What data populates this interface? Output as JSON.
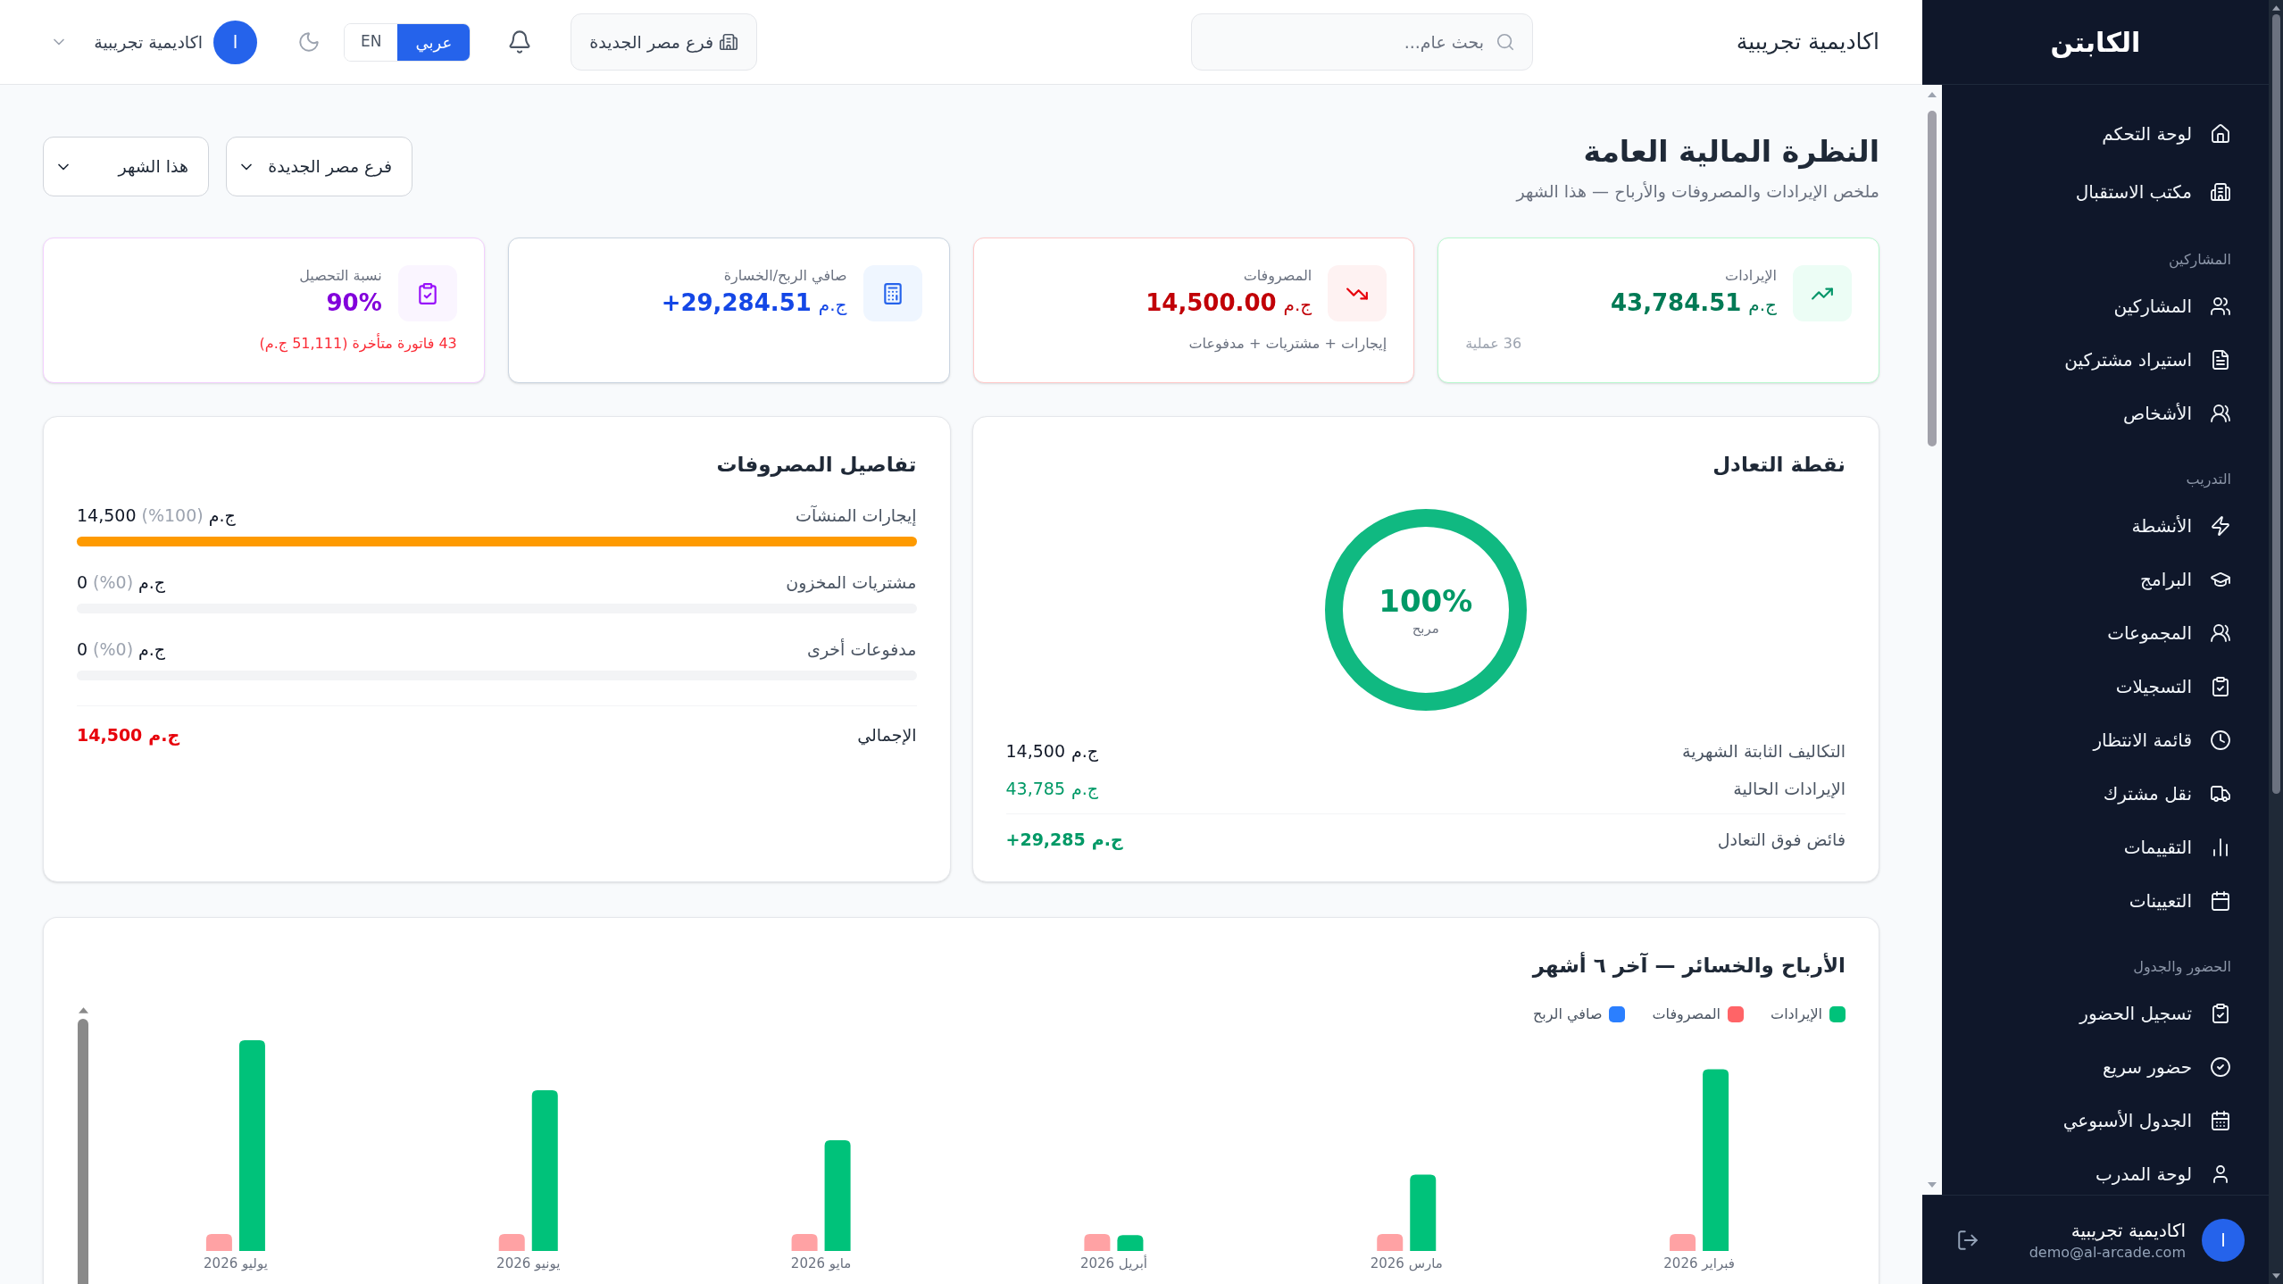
{
  "sidebar": {
    "brand": "الكابتن",
    "sections": [
      {
        "items": [
          {
            "label": "لوحة التحكم",
            "selected": false
          },
          {
            "label": "مكتب الاستقبال",
            "selected": false
          }
        ]
      },
      {
        "heading": "المشاركين",
        "items": [
          {
            "label": "المشاركين",
            "selected": false
          },
          {
            "label": "استيراد مشتركين",
            "selected": false
          },
          {
            "label": "الأشخاص",
            "selected": false
          }
        ]
      },
      {
        "heading": "التدريب",
        "items": [
          {
            "label": "الأنشطة",
            "selected": false
          },
          {
            "label": "البرامج",
            "selected": false
          },
          {
            "label": "المجموعات",
            "selected": false
          },
          {
            "label": "التسجيلات",
            "selected": false
          },
          {
            "label": "قائمة الانتظار",
            "selected": false
          },
          {
            "label": "نقل مشترك",
            "selected": false
          },
          {
            "label": "التقييمات",
            "selected": false
          },
          {
            "label": "التعيينات",
            "selected": false
          }
        ]
      },
      {
        "heading": "الحضور والجدول",
        "items": [
          {
            "label": "تسجيل الحضور",
            "selected": false
          },
          {
            "label": "حضور سريع",
            "selected": false
          },
          {
            "label": "الجدول الأسبوعي",
            "selected": false
          },
          {
            "label": "لوحة المدرب",
            "selected": false
          }
        ]
      }
    ],
    "user": {
      "initial": "ا",
      "name": "اكاديمية تجريبية",
      "email": "demo@al-arcade.com"
    }
  },
  "header": {
    "title": "اكاديمية تجريبية",
    "search": {
      "placeholder": "بحث عام..."
    },
    "branch_button": "فرع مصر الجديدة",
    "languages": [
      {
        "label": "عربي",
        "selected": true
      },
      {
        "label": "EN",
        "selected": false
      }
    ],
    "user": {
      "initial": "ا",
      "name": "اكاديمية تجريبية"
    }
  },
  "page": {
    "title": "النظرة المالية العامة",
    "subtitle": "ملخص الإيرادات والمصروفات والأرباح — هذا الشهر",
    "filters": [
      {
        "value": "فرع مصر الجديدة"
      },
      {
        "value": "هذا الشهر"
      }
    ]
  },
  "stat_cards": [
    {
      "kind": "revenue",
      "label": "الإيرادات",
      "currency": "ج.م",
      "value": "43,784.51",
      "note": "36 عملية"
    },
    {
      "kind": "expenses",
      "label": "المصروفات",
      "currency": "ج.م",
      "value": "14,500.00",
      "note": "إيجارات + مشتريات + مدفوعات"
    },
    {
      "kind": "net",
      "label": "صافي الربح/الخسارة",
      "currency": "ج.م",
      "value": "+29,284.51"
    },
    {
      "kind": "collection",
      "label": "نسبة التحصيل",
      "value": "90%",
      "note": "43 فاتورة متأخرة (51,111 ج.م)"
    }
  ],
  "breakeven": {
    "title": "نقطة التعادل",
    "level": 1,
    "percent": "100%",
    "status": "مربح",
    "rows": [
      {
        "kind": "plain",
        "label": "التكاليف الثابتة الشهرية",
        "amount": "14,500",
        "currency": "ج.م"
      },
      {
        "kind": "positive",
        "label": "الإيرادات الحالية",
        "amount": "43,785",
        "currency": "ج.م"
      },
      {
        "kind": "surplus",
        "label": "فائض فوق التعادل",
        "amount": "+29,285",
        "currency": "ج.م"
      }
    ]
  },
  "expense_details": {
    "title": "تفاصيل المصروفات",
    "rows": [
      {
        "label": "إيجارات المنشآت",
        "amount": "14,500",
        "share": "(%100)",
        "currency": "ج.م",
        "level": 1
      },
      {
        "label": "مشتريات المخزون",
        "amount": "0",
        "share": "(%0)",
        "currency": "ج.م",
        "level": 0
      },
      {
        "label": "مدفوعات أخرى",
        "amount": "0",
        "share": "(%0)",
        "currency": "ج.م",
        "level": 0
      }
    ],
    "total": {
      "label": "الإجمالي",
      "amount": "14,500",
      "currency": "ج.م"
    }
  },
  "profit_loss_chart": {
    "title": "الأرباح والخسائر — آخر ٦ أشهر",
    "legend": [
      {
        "label": "الإيرادات",
        "color": "#00c27a"
      },
      {
        "label": "المصروفات",
        "color": "#ff6467"
      },
      {
        "label": "صافي الربح",
        "color": "#2b7fff"
      }
    ],
    "months": [
      "فبراير 2026",
      "مارس 2026",
      "أبريل 2026",
      "مايو 2026",
      "يونيو 2026",
      "يوليو 2026"
    ]
  }
}
